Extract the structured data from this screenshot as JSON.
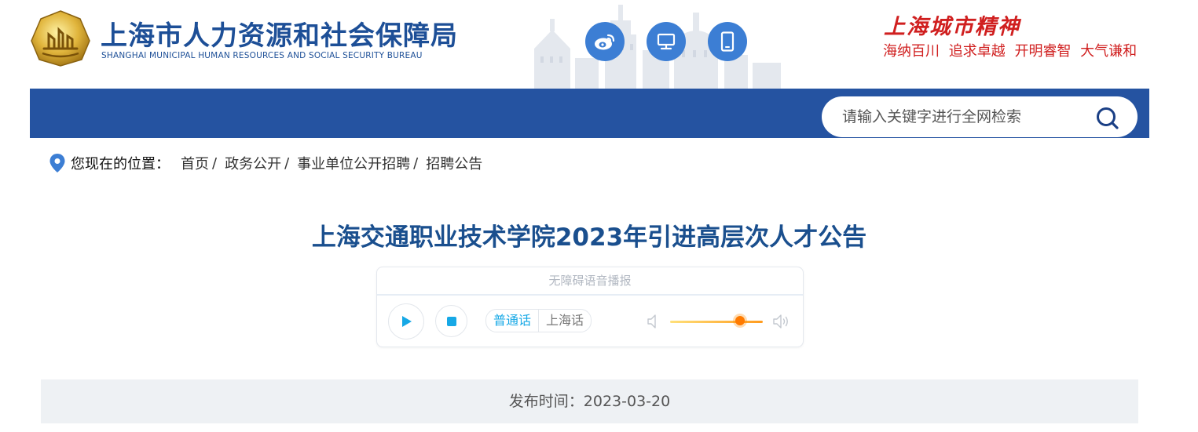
{
  "header": {
    "org_name_cn": "上海市人力资源和社会保障局",
    "org_name_en": "SHANGHAI MUNICIPAL HUMAN RESOURCES AND SOCIAL SECURITY BUREAU",
    "social_icons": [
      "weibo-icon",
      "desktop-icon",
      "mobile-icon"
    ],
    "spirit_title": "上海城市精神",
    "spirit_motto": "海纳百川 追求卓越 开明睿智 大气谦和"
  },
  "search": {
    "placeholder": "请输入关键字进行全网检索",
    "value": ""
  },
  "breadcrumb": {
    "label": "您现在的位置：",
    "items": [
      "首页",
      "政务公开",
      "事业单位公开招聘",
      "招聘公告"
    ],
    "separator": "/"
  },
  "article": {
    "title": "上海交通职业技术学院2023年引进高层次人才公告",
    "publish_label": "发布时间：2023-03-20"
  },
  "player": {
    "header": "无障碍语音播报",
    "languages": [
      "普通话",
      "上海话"
    ],
    "selected_language": "普通话",
    "volume": 0.8
  },
  "colors": {
    "brand_blue": "#2553a1",
    "title_blue": "#1a4f8e",
    "accent_red": "#d01f1f",
    "player_accent": "#16a8e6",
    "volume_orange": "#ff7a00"
  }
}
